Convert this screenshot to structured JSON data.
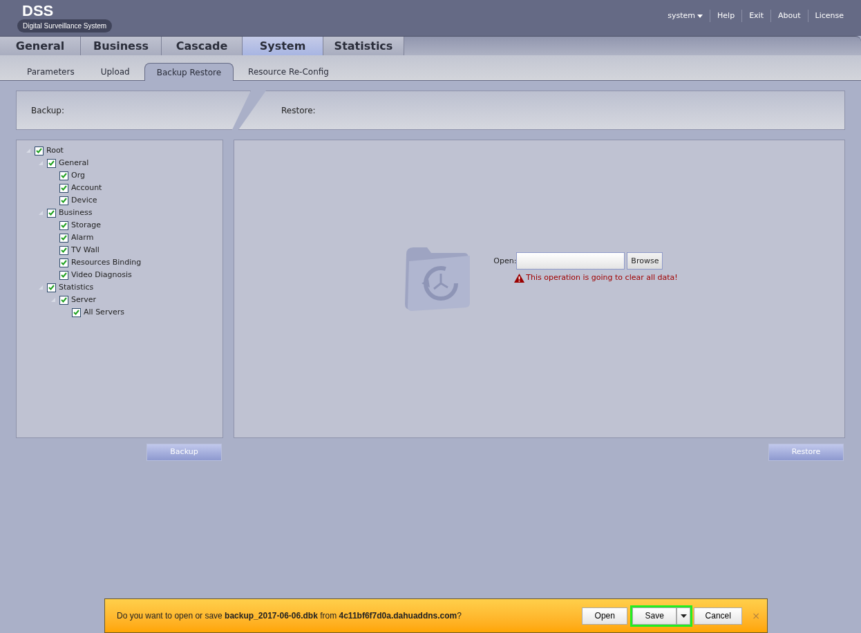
{
  "logo": {
    "title": "DSS",
    "subtitle": "Digital Surveillance System"
  },
  "top_links": [
    {
      "label": "system",
      "kind": "dropdown"
    },
    {
      "label": "Help",
      "kind": "link"
    },
    {
      "label": "Exit",
      "kind": "link"
    },
    {
      "label": "About",
      "kind": "link"
    },
    {
      "label": "License",
      "kind": "link"
    }
  ],
  "main_tabs": [
    {
      "label": "General",
      "selected": false
    },
    {
      "label": "Business",
      "selected": false
    },
    {
      "label": "Cascade",
      "selected": false
    },
    {
      "label": "System",
      "selected": true
    },
    {
      "label": "Statistics",
      "selected": false
    }
  ],
  "sub_tabs": [
    {
      "label": "Parameters",
      "selected": false
    },
    {
      "label": "Upload",
      "selected": false
    },
    {
      "label": "Backup Restore",
      "selected": true
    },
    {
      "label": "Resource Re-Config",
      "selected": false
    }
  ],
  "backup_header": "Backup:",
  "restore_header": "Restore:",
  "tree": [
    {
      "label": "Root",
      "checked": true,
      "expanded": true,
      "children": [
        {
          "label": "General",
          "checked": true,
          "expanded": true,
          "children": [
            {
              "label": "Org",
              "checked": true
            },
            {
              "label": "Account",
              "checked": true
            },
            {
              "label": "Device",
              "checked": true
            }
          ]
        },
        {
          "label": "Business",
          "checked": true,
          "expanded": true,
          "children": [
            {
              "label": "Storage",
              "checked": true
            },
            {
              "label": "Alarm",
              "checked": true
            },
            {
              "label": "TV Wall",
              "checked": true
            },
            {
              "label": "Resources Binding",
              "checked": true
            },
            {
              "label": "Video Diagnosis",
              "checked": true
            }
          ]
        },
        {
          "label": "Statistics",
          "checked": true,
          "expanded": true,
          "children": [
            {
              "label": "Server",
              "checked": true,
              "expanded": true,
              "children": [
                {
                  "label": "All Servers",
                  "checked": true
                }
              ]
            }
          ]
        }
      ]
    }
  ],
  "restore": {
    "open_label": "Open:",
    "browse": "Browse",
    "warning": "This operation is going to clear all data!"
  },
  "backup_button": "Backup",
  "restore_button": "Restore",
  "download_bar": {
    "message": "Do you want to open or save **backup_2017-06-06.dbk** from **4c11bf6f7d0a.dahuaddns.com**?",
    "open": "Open",
    "save": "Save",
    "save_highlighted": true,
    "cancel": "Cancel",
    "close": "×"
  }
}
